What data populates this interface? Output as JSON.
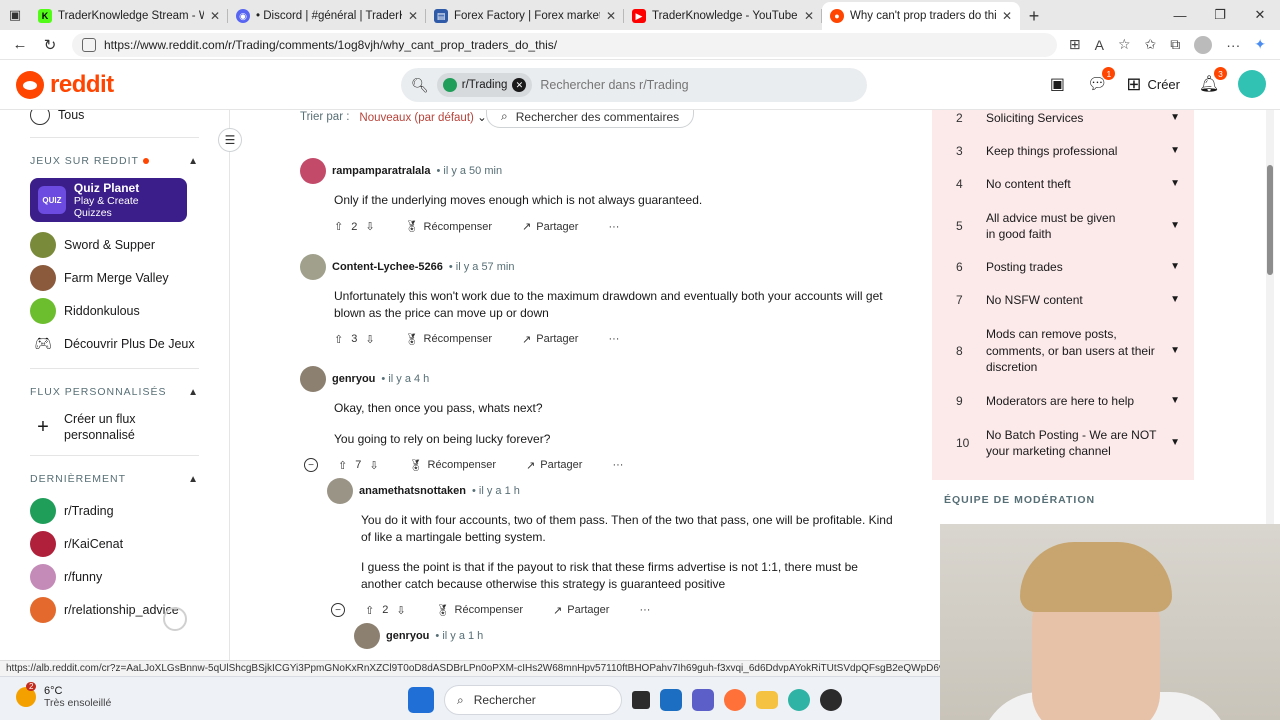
{
  "browser": {
    "tabs": [
      {
        "title": "TraderKnowledge Stream - Watch",
        "icon": "kick-icon",
        "color": "#53fc18"
      },
      {
        "title": "• Discord | #général | TraderKnow",
        "icon": "discord-icon",
        "color": "#5865f2"
      },
      {
        "title": "Forex Factory | Forex markets for",
        "icon": "forexfactory-icon",
        "color": "#2f5aa8"
      },
      {
        "title": "TraderKnowledge - YouTube",
        "icon": "youtube-icon",
        "color": "#ff0000"
      },
      {
        "title": "Why can't prop traders do this? :",
        "icon": "reddit-icon",
        "color": "#ff4500",
        "active": true
      }
    ],
    "url": "https://www.reddit.com/r/Trading/comments/1og8vjh/why_cant_prop_traders_do_this/"
  },
  "header": {
    "logo_text": "reddit",
    "search_chip": "r/Trading",
    "search_placeholder": "Rechercher dans r/Trading",
    "chat_badge": "1",
    "create_label": "Créer",
    "notif_badge": "3"
  },
  "left_sidebar": {
    "top_partial": "Tous",
    "games_title": "JEUX SUR REDDIT",
    "quiz": {
      "title": "Quiz Planet",
      "subtitle": "Play & Create Quizzes",
      "icon_text": "QUIZ"
    },
    "games": [
      {
        "label": "Sword & Supper",
        "color": "#7a8a3b"
      },
      {
        "label": "Farm Merge Valley",
        "color": "#8b5a3c"
      },
      {
        "label": "Riddonkulous",
        "color": "#6cbe2e"
      }
    ],
    "discover_label": "Découvrir Plus De Jeux",
    "custom_feeds_title": "FLUX PERSONNALISÉS",
    "create_feed_label": "Créer un flux personnalisé",
    "recent_title": "DERNIÈREMENT",
    "recent": [
      {
        "label": "r/Trading",
        "color": "#1f9e5a"
      },
      {
        "label": "r/KaiCenat",
        "color": "#b0203a"
      },
      {
        "label": "r/funny",
        "color": "#c48bb8"
      },
      {
        "label": "r/relationship_advice",
        "color": "#e36a2c"
      }
    ]
  },
  "sort": {
    "label": "Trier par :",
    "value": "Nouveaux (par défaut)",
    "search_comments": "Rechercher des commentaires"
  },
  "actions": {
    "award": "Récompenser",
    "share": "Partager",
    "more": "···"
  },
  "comments": [
    {
      "user": "rampamparatralala",
      "time": "il y a 50 min",
      "body": [
        "Only if the underlying moves enough which is not always guaranteed."
      ],
      "votes": "2",
      "avatar_color": "#c44a6a"
    },
    {
      "user": "Content-Lychee-5266",
      "time": "il y a 57 min",
      "body": [
        "Unfortunately this won't work due to the maximum drawdown and eventually both your accounts will get blown as the price can move up or down"
      ],
      "votes": "3",
      "avatar_color": "#a0a08c"
    },
    {
      "user": "genryou",
      "time": "il y a 4 h",
      "body": [
        "Okay, then once you pass, whats next?",
        "You going to rely on being lucky forever?"
      ],
      "votes": "7",
      "avatar_color": "#8c8070"
    },
    {
      "user": "anamethatsnottaken",
      "time": "il y a 1 h",
      "body": [
        "You do it with four accounts, two of them pass. Then of the two that pass, one will be profitable. Kind of like a martingale betting system.",
        "I guess the point is that if the payout to risk that these firms advertise is not 1:1, there must be another catch because otherwise this strategy is guaranteed positive"
      ],
      "votes": "2",
      "avatar_color": "#9a9486"
    },
    {
      "user": "genryou",
      "time": "il y a 1 h",
      "avatar_color": "#8c8070"
    }
  ],
  "rules": [
    {
      "num": "2",
      "text": "Soliciting Services"
    },
    {
      "num": "3",
      "text": "Keep things professional"
    },
    {
      "num": "4",
      "text": "No content theft"
    },
    {
      "num": "5",
      "text": "All advice must be given in good faith"
    },
    {
      "num": "6",
      "text": "Posting trades"
    },
    {
      "num": "7",
      "text": "No NSFW content"
    },
    {
      "num": "8",
      "text": "Mods can remove posts, comments, or ban users at their discretion"
    },
    {
      "num": "9",
      "text": "Moderators are here to help"
    },
    {
      "num": "10",
      "text": "No Batch Posting - We are NOT your marketing channel"
    }
  ],
  "mod_team_title": "ÉQUIPE DE MODÉRATION",
  "status_url": "https://alb.reddit.com/cr?z=AaLJoXLGsBnnw-5qUlShcgBSjkICGYi3PpmGNoKxRnXZCl9T0oD8dASDBrLPn0oPXM-cIHs2W68mnHpv57110ftBHOPahv7Ih69guh-f3xvqi_6d6DdvpAYokRiTUtSVdpQFsgB2eQWpD6v32NH",
  "taskbar": {
    "weather_temp": "6°C",
    "weather_cond": "Très ensoleillé",
    "weather_badge": "2",
    "search_label": "Rechercher"
  }
}
